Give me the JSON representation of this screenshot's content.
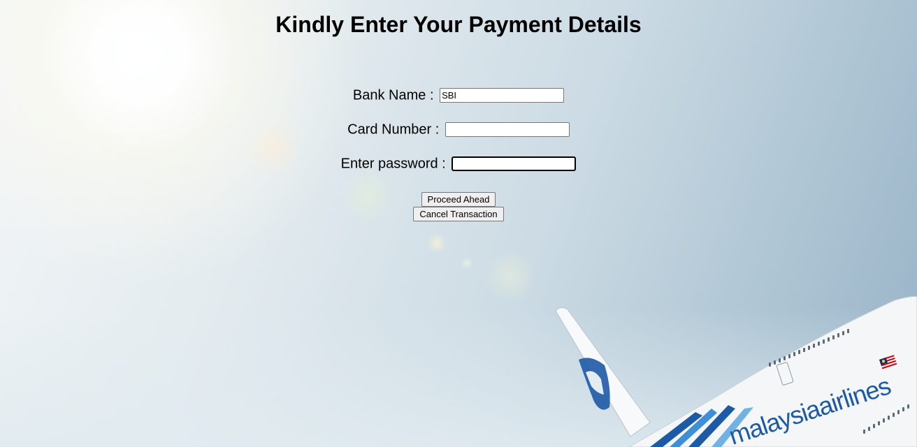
{
  "title": "Kindly Enter Your Payment Details",
  "form": {
    "bank": {
      "label": "Bank Name :",
      "value": "SBI"
    },
    "card": {
      "label": "Card Number :",
      "value": ""
    },
    "password": {
      "label": "Enter password :",
      "value": ""
    }
  },
  "buttons": {
    "proceed": "Proceed Ahead",
    "cancel": "Cancel Transaction"
  },
  "background": {
    "airline_livery_text": "malaysiaairlines",
    "colors": {
      "sky_light": "#f2f5f7",
      "sky_dark": "#97b2c6",
      "livery_blue": "#1d5aa6"
    }
  }
}
